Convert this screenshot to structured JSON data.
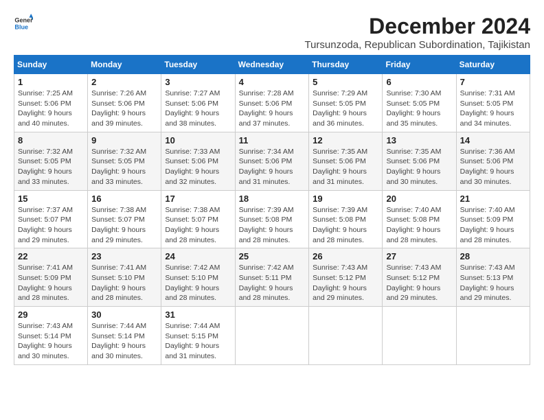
{
  "header": {
    "logo_line1": "General",
    "logo_line2": "Blue",
    "title": "December 2024",
    "subtitle": "Tursunzoda, Republican Subordination, Tajikistan"
  },
  "columns": [
    "Sunday",
    "Monday",
    "Tuesday",
    "Wednesday",
    "Thursday",
    "Friday",
    "Saturday"
  ],
  "weeks": [
    [
      {
        "day": "1",
        "sunrise": "Sunrise: 7:25 AM",
        "sunset": "Sunset: 5:06 PM",
        "daylight": "Daylight: 9 hours and 40 minutes."
      },
      {
        "day": "2",
        "sunrise": "Sunrise: 7:26 AM",
        "sunset": "Sunset: 5:06 PM",
        "daylight": "Daylight: 9 hours and 39 minutes."
      },
      {
        "day": "3",
        "sunrise": "Sunrise: 7:27 AM",
        "sunset": "Sunset: 5:06 PM",
        "daylight": "Daylight: 9 hours and 38 minutes."
      },
      {
        "day": "4",
        "sunrise": "Sunrise: 7:28 AM",
        "sunset": "Sunset: 5:06 PM",
        "daylight": "Daylight: 9 hours and 37 minutes."
      },
      {
        "day": "5",
        "sunrise": "Sunrise: 7:29 AM",
        "sunset": "Sunset: 5:05 PM",
        "daylight": "Daylight: 9 hours and 36 minutes."
      },
      {
        "day": "6",
        "sunrise": "Sunrise: 7:30 AM",
        "sunset": "Sunset: 5:05 PM",
        "daylight": "Daylight: 9 hours and 35 minutes."
      },
      {
        "day": "7",
        "sunrise": "Sunrise: 7:31 AM",
        "sunset": "Sunset: 5:05 PM",
        "daylight": "Daylight: 9 hours and 34 minutes."
      }
    ],
    [
      {
        "day": "8",
        "sunrise": "Sunrise: 7:32 AM",
        "sunset": "Sunset: 5:05 PM",
        "daylight": "Daylight: 9 hours and 33 minutes."
      },
      {
        "day": "9",
        "sunrise": "Sunrise: 7:32 AM",
        "sunset": "Sunset: 5:05 PM",
        "daylight": "Daylight: 9 hours and 33 minutes."
      },
      {
        "day": "10",
        "sunrise": "Sunrise: 7:33 AM",
        "sunset": "Sunset: 5:06 PM",
        "daylight": "Daylight: 9 hours and 32 minutes."
      },
      {
        "day": "11",
        "sunrise": "Sunrise: 7:34 AM",
        "sunset": "Sunset: 5:06 PM",
        "daylight": "Daylight: 9 hours and 31 minutes."
      },
      {
        "day": "12",
        "sunrise": "Sunrise: 7:35 AM",
        "sunset": "Sunset: 5:06 PM",
        "daylight": "Daylight: 9 hours and 31 minutes."
      },
      {
        "day": "13",
        "sunrise": "Sunrise: 7:35 AM",
        "sunset": "Sunset: 5:06 PM",
        "daylight": "Daylight: 9 hours and 30 minutes."
      },
      {
        "day": "14",
        "sunrise": "Sunrise: 7:36 AM",
        "sunset": "Sunset: 5:06 PM",
        "daylight": "Daylight: 9 hours and 30 minutes."
      }
    ],
    [
      {
        "day": "15",
        "sunrise": "Sunrise: 7:37 AM",
        "sunset": "Sunset: 5:07 PM",
        "daylight": "Daylight: 9 hours and 29 minutes."
      },
      {
        "day": "16",
        "sunrise": "Sunrise: 7:38 AM",
        "sunset": "Sunset: 5:07 PM",
        "daylight": "Daylight: 9 hours and 29 minutes."
      },
      {
        "day": "17",
        "sunrise": "Sunrise: 7:38 AM",
        "sunset": "Sunset: 5:07 PM",
        "daylight": "Daylight: 9 hours and 28 minutes."
      },
      {
        "day": "18",
        "sunrise": "Sunrise: 7:39 AM",
        "sunset": "Sunset: 5:08 PM",
        "daylight": "Daylight: 9 hours and 28 minutes."
      },
      {
        "day": "19",
        "sunrise": "Sunrise: 7:39 AM",
        "sunset": "Sunset: 5:08 PM",
        "daylight": "Daylight: 9 hours and 28 minutes."
      },
      {
        "day": "20",
        "sunrise": "Sunrise: 7:40 AM",
        "sunset": "Sunset: 5:08 PM",
        "daylight": "Daylight: 9 hours and 28 minutes."
      },
      {
        "day": "21",
        "sunrise": "Sunrise: 7:40 AM",
        "sunset": "Sunset: 5:09 PM",
        "daylight": "Daylight: 9 hours and 28 minutes."
      }
    ],
    [
      {
        "day": "22",
        "sunrise": "Sunrise: 7:41 AM",
        "sunset": "Sunset: 5:09 PM",
        "daylight": "Daylight: 9 hours and 28 minutes."
      },
      {
        "day": "23",
        "sunrise": "Sunrise: 7:41 AM",
        "sunset": "Sunset: 5:10 PM",
        "daylight": "Daylight: 9 hours and 28 minutes."
      },
      {
        "day": "24",
        "sunrise": "Sunrise: 7:42 AM",
        "sunset": "Sunset: 5:10 PM",
        "daylight": "Daylight: 9 hours and 28 minutes."
      },
      {
        "day": "25",
        "sunrise": "Sunrise: 7:42 AM",
        "sunset": "Sunset: 5:11 PM",
        "daylight": "Daylight: 9 hours and 28 minutes."
      },
      {
        "day": "26",
        "sunrise": "Sunrise: 7:43 AM",
        "sunset": "Sunset: 5:12 PM",
        "daylight": "Daylight: 9 hours and 29 minutes."
      },
      {
        "day": "27",
        "sunrise": "Sunrise: 7:43 AM",
        "sunset": "Sunset: 5:12 PM",
        "daylight": "Daylight: 9 hours and 29 minutes."
      },
      {
        "day": "28",
        "sunrise": "Sunrise: 7:43 AM",
        "sunset": "Sunset: 5:13 PM",
        "daylight": "Daylight: 9 hours and 29 minutes."
      }
    ],
    [
      {
        "day": "29",
        "sunrise": "Sunrise: 7:43 AM",
        "sunset": "Sunset: 5:14 PM",
        "daylight": "Daylight: 9 hours and 30 minutes."
      },
      {
        "day": "30",
        "sunrise": "Sunrise: 7:44 AM",
        "sunset": "Sunset: 5:14 PM",
        "daylight": "Daylight: 9 hours and 30 minutes."
      },
      {
        "day": "31",
        "sunrise": "Sunrise: 7:44 AM",
        "sunset": "Sunset: 5:15 PM",
        "daylight": "Daylight: 9 hours and 31 minutes."
      },
      null,
      null,
      null,
      null
    ]
  ]
}
